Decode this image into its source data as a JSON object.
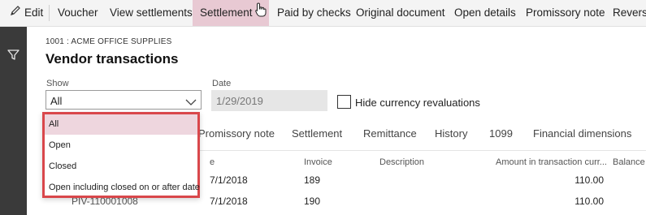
{
  "toolbar": {
    "items": [
      {
        "label": "Edit",
        "icon": "pencil-icon"
      },
      {
        "label": "Voucher"
      },
      {
        "label": "View settlements"
      },
      {
        "label": "Settlement",
        "active": true
      },
      {
        "label": "Paid by checks"
      },
      {
        "label": "Original document"
      },
      {
        "label": "Open details"
      },
      {
        "label": "Promissory note"
      },
      {
        "label": "Reverse"
      }
    ]
  },
  "header": {
    "breadcrumb": "1001 : ACME OFFICE SUPPLIES",
    "title": "Vendor transactions"
  },
  "filters": {
    "show_label": "Show",
    "show_value": "All",
    "date_label": "Date",
    "date_value": "1/29/2019",
    "hide_revaluations_label": "Hide currency revaluations",
    "hide_revaluations_checked": false
  },
  "dropdown": {
    "options": [
      "All",
      "Open",
      "Closed",
      "Open including closed on or after date"
    ],
    "selected": "All"
  },
  "tabs": [
    "Promissory note",
    "Settlement",
    "Remittance",
    "History",
    "1099",
    "Financial dimensions"
  ],
  "grid": {
    "columns": [
      "e",
      "Invoice",
      "Description",
      "Amount in transaction curr...",
      "Balance i"
    ],
    "rows": [
      {
        "voucher": "",
        "date": "7/1/2018",
        "invoice": "189",
        "description": "",
        "amount": "110.00"
      },
      {
        "voucher": "PIV-110001008",
        "date": "7/1/2018",
        "invoice": "190",
        "description": "",
        "amount": "110.00"
      }
    ]
  },
  "colors": {
    "accent": "#e8c9d3",
    "highlight_border": "#d9474b",
    "nav_bar": "#3a3a3a"
  }
}
